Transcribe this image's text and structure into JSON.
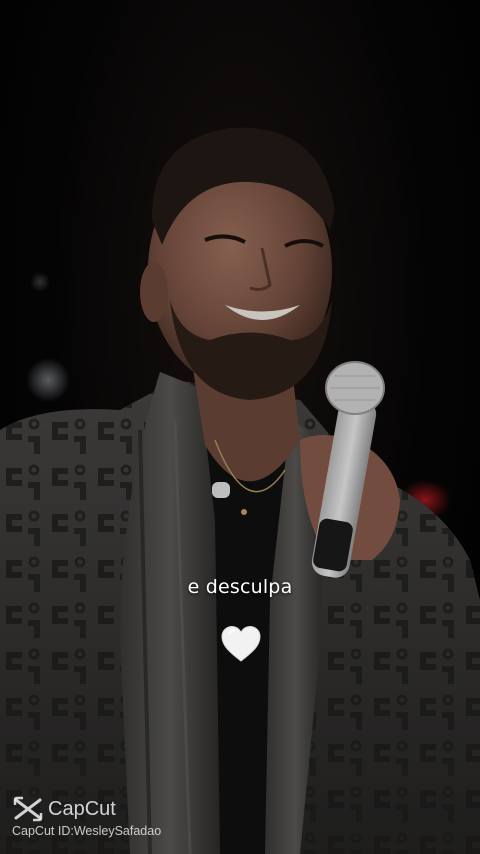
{
  "video": {
    "caption": "e desculpa",
    "emoji": "white-heart-icon",
    "background_color": "#000000"
  },
  "watermark": {
    "brand": "CapCut",
    "id_text": "CapCut ID:WesleySafadao",
    "logo_icon": "capcut-logo-icon"
  },
  "colors": {
    "caption": "#ffffff",
    "heart": "#f2f2f2",
    "bokeh_red": "#b0191e"
  }
}
